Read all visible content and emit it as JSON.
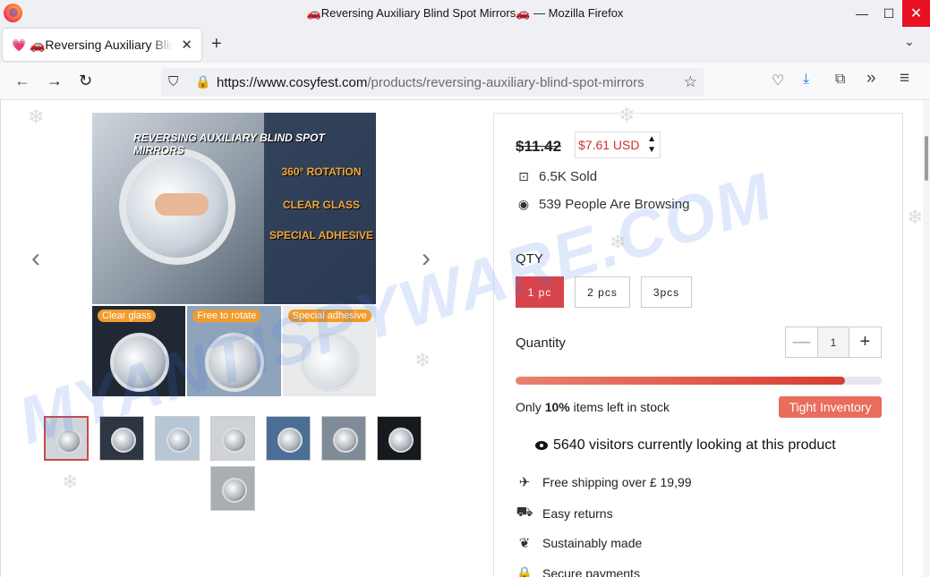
{
  "window": {
    "title": "🚗Reversing Auxiliary Blind Spot Mirrors🚗 — Mozilla Firefox",
    "minimize": "—",
    "maximize": "☐",
    "close": "✕"
  },
  "tab": {
    "label": "🚗Reversing Auxiliary Blind Spot Mirrors🚗",
    "favicon": "💗",
    "close": "✕",
    "new_tab": "+",
    "list_all": "⌄"
  },
  "nav": {
    "back": "←",
    "forward": "→",
    "reload": "↻",
    "url_domain": "https://www.cosyfest.com",
    "url_path": "/products/reversing-auxiliary-blind-spot-mirrors",
    "bookmark": "☆",
    "pocket": "♡",
    "download": "⤓",
    "extensions": "⧉",
    "more_tools": "»",
    "menu": "≡"
  },
  "gallery": {
    "prev": "‹",
    "next": "›",
    "headline": "REVERSING AUXILIARY BLIND SPOT MIRRORS",
    "features": [
      "360° ROTATION",
      "CLEAR GLASS",
      "SPECIAL ADHESIVE"
    ],
    "tiles": [
      "Clear glass",
      "Free to rotate",
      "Special adhesive"
    ],
    "thumbnail_count": 8
  },
  "watermark": "MYANTISPYWARE.COM",
  "product": {
    "old_price": "$11.42",
    "new_price": "$7.61 USD",
    "price_toggle": "▲\n▼",
    "sold": "6.5K Sold",
    "browsing": "539 People Are Browsing",
    "qty_title": "QTY",
    "options": [
      {
        "label": "1 pc",
        "selected": true
      },
      {
        "label": "2 pcs",
        "selected": false
      },
      {
        "label": "3pcs",
        "selected": false
      }
    ],
    "quantity_label": "Quantity",
    "quantity_value": "1",
    "minus": "—",
    "plus": "+",
    "stock_fill_percent": 90,
    "stock_prefix": "Only ",
    "stock_percent": "10%",
    "stock_suffix": " items left in stock",
    "badge": "Tight Inventory",
    "visitors": "5640 visitors currently looking at this product",
    "features": [
      {
        "icon": "pin-icon",
        "glyph": "✈",
        "label": "Free shipping over  £ 19,99"
      },
      {
        "icon": "truck-icon",
        "glyph": "⛟",
        "label": "Easy returns"
      },
      {
        "icon": "leaf-icon",
        "glyph": "❦",
        "label": "Sustainably made"
      },
      {
        "icon": "lock-icon",
        "glyph": "🔒",
        "label": "Secure payments"
      }
    ]
  },
  "colors": {
    "accent": "#d8444c",
    "price_red": "#d0312d",
    "badge": "#e96c5c",
    "close_red": "#e81123"
  }
}
